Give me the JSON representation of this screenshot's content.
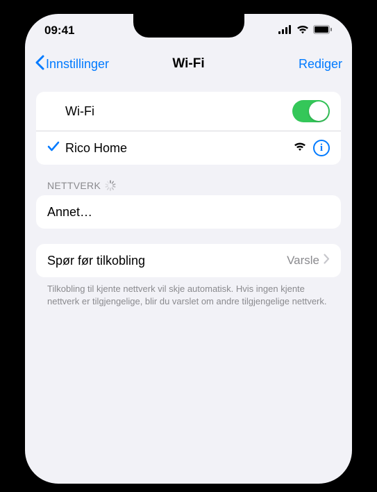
{
  "status": {
    "time": "09:41"
  },
  "nav": {
    "back": "Innstillinger",
    "title": "Wi-Fi",
    "edit": "Rediger"
  },
  "wifi": {
    "toggle_label": "Wi-Fi",
    "toggle_on": true,
    "connected_network": "Rico Home"
  },
  "networks": {
    "header": "NETTVERK",
    "other": "Annet…"
  },
  "ask": {
    "label": "Spør før tilkobling",
    "value": "Varsle",
    "footer": "Tilkobling til kjente nettverk vil skje automatisk. Hvis ingen kjente nettverk er tilgjengelige, blir du varslet om andre tilgjengelige nettverk."
  }
}
